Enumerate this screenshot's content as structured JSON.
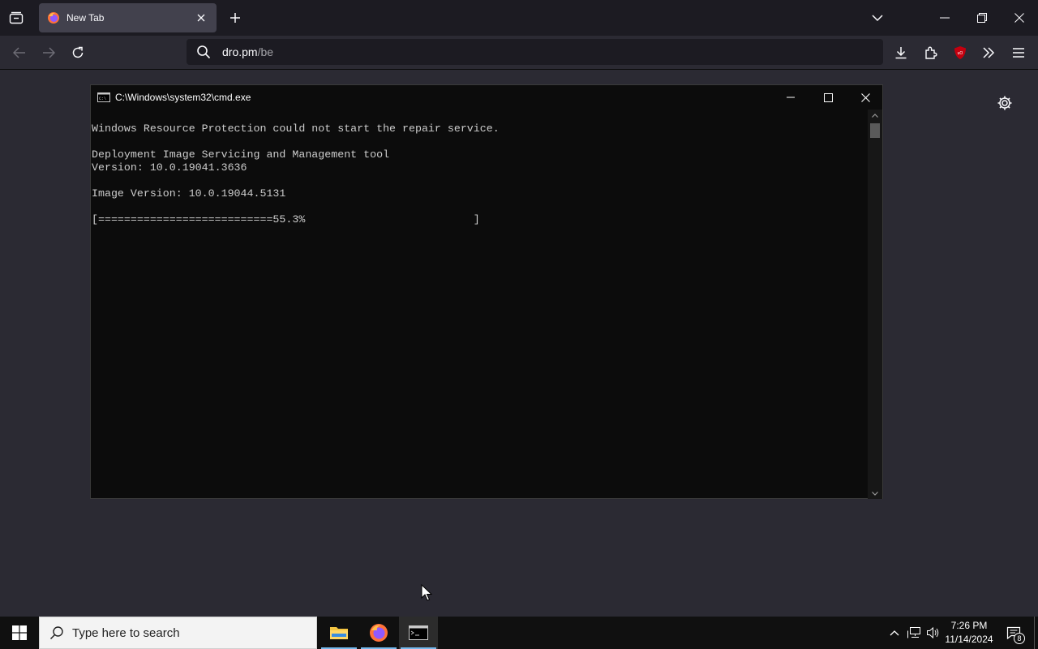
{
  "browser": {
    "tab": {
      "title": "New Tab"
    },
    "url": {
      "host": "dro.pm",
      "path": "/be"
    }
  },
  "cmd": {
    "title": "C:\\Windows\\system32\\cmd.exe",
    "lines": [
      "Windows Resource Protection could not start the repair service.",
      "",
      "Deployment Image Servicing and Management tool",
      "Version: 10.0.19041.3636",
      "",
      "Image Version: 10.0.19044.5131",
      "",
      "[===========================55.3%                          ]"
    ],
    "progress_percent": 55.3
  },
  "taskbar": {
    "search_placeholder": "Type here to search",
    "clock_time": "7:26 PM",
    "clock_date": "11/14/2024",
    "notification_count": "8"
  },
  "colors": {
    "browser_bg": "#2b2a33",
    "cmd_bg": "#0c0c0c",
    "cmd_text": "#cccccc",
    "taskbar_bg": "#101010",
    "ublock_red": "#c4000f"
  }
}
